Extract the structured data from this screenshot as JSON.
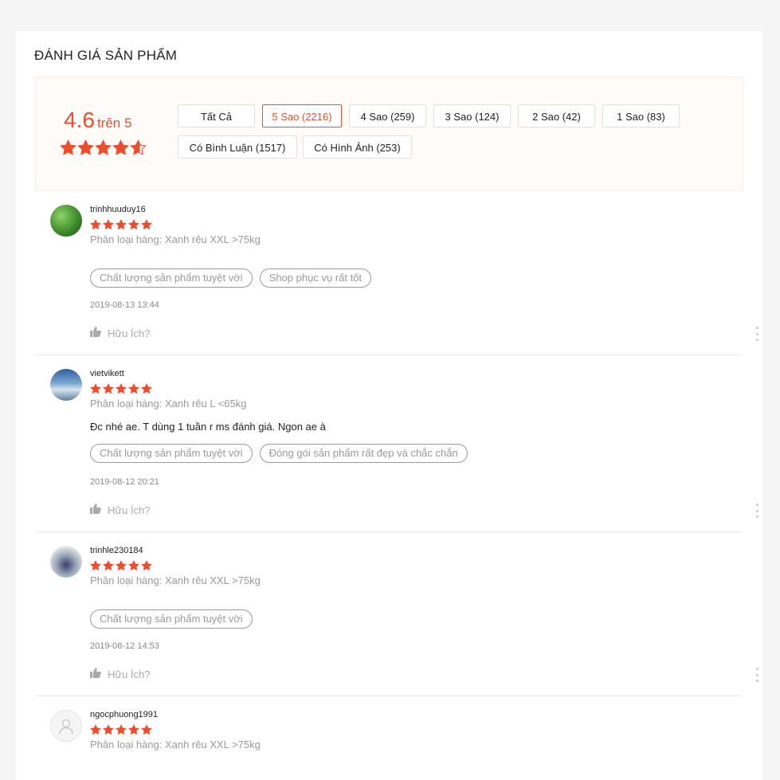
{
  "section": {
    "title": "ĐÁNH GIÁ SẢN PHẨM"
  },
  "overview": {
    "score": "4.6",
    "score_suffix": "trên 5",
    "rating": 4.6,
    "max_rating": 5,
    "filters": [
      {
        "label": "Tất Cả",
        "active": false
      },
      {
        "label": "5 Sao (2216)",
        "active": true
      },
      {
        "label": "4 Sao (259)",
        "active": false
      },
      {
        "label": "3 Sao (124)",
        "active": false
      },
      {
        "label": "2 Sao (42)",
        "active": false
      },
      {
        "label": "1 Sao (83)",
        "active": false
      },
      {
        "label": "Có Bình Luận (1517)",
        "active": false
      },
      {
        "label": "Có Hình Ảnh (253)",
        "active": false
      }
    ]
  },
  "colors": {
    "accent": "#ee4d2d",
    "muted": "#999999",
    "panel": "#fffbf8"
  },
  "reviews": [
    {
      "username": "trinhhuuduy16",
      "stars": 5,
      "variation": "Phân loại hàng: Xanh rêu XXL >75kg",
      "comment": "",
      "tags": [
        "Chất lượng sản phẩm tuyệt vời",
        "Shop phục vụ rất tốt"
      ],
      "date": "2019-08-13 13:44",
      "helpful": "Hữu Ích?"
    },
    {
      "username": "vietvikett",
      "stars": 5,
      "variation": "Phân loại hàng: Xanh rêu L <65kg",
      "comment": "Đc nhé ae. T dùng 1 tuần r ms đánh giá. Ngon ae à",
      "tags": [
        "Chất lượng sản phẩm tuyệt vời",
        "Đóng gói sản phẩm rất đẹp và chắc chắn"
      ],
      "date": "2019-08-12 20:21",
      "helpful": "Hữu Ích?"
    },
    {
      "username": "trinhle230184",
      "stars": 5,
      "variation": "Phân loại hàng: Xanh rêu XXL >75kg",
      "comment": "",
      "tags": [
        "Chất lượng sản phẩm tuyệt vời"
      ],
      "date": "2019-08-12 14:53",
      "helpful": "Hữu Ích?"
    },
    {
      "username": "ngocphuong1991",
      "stars": 5,
      "variation": "Phân loại hàng: Xanh rêu XXL >75kg",
      "comment": "",
      "tags": [],
      "date": "",
      "helpful": ""
    }
  ]
}
